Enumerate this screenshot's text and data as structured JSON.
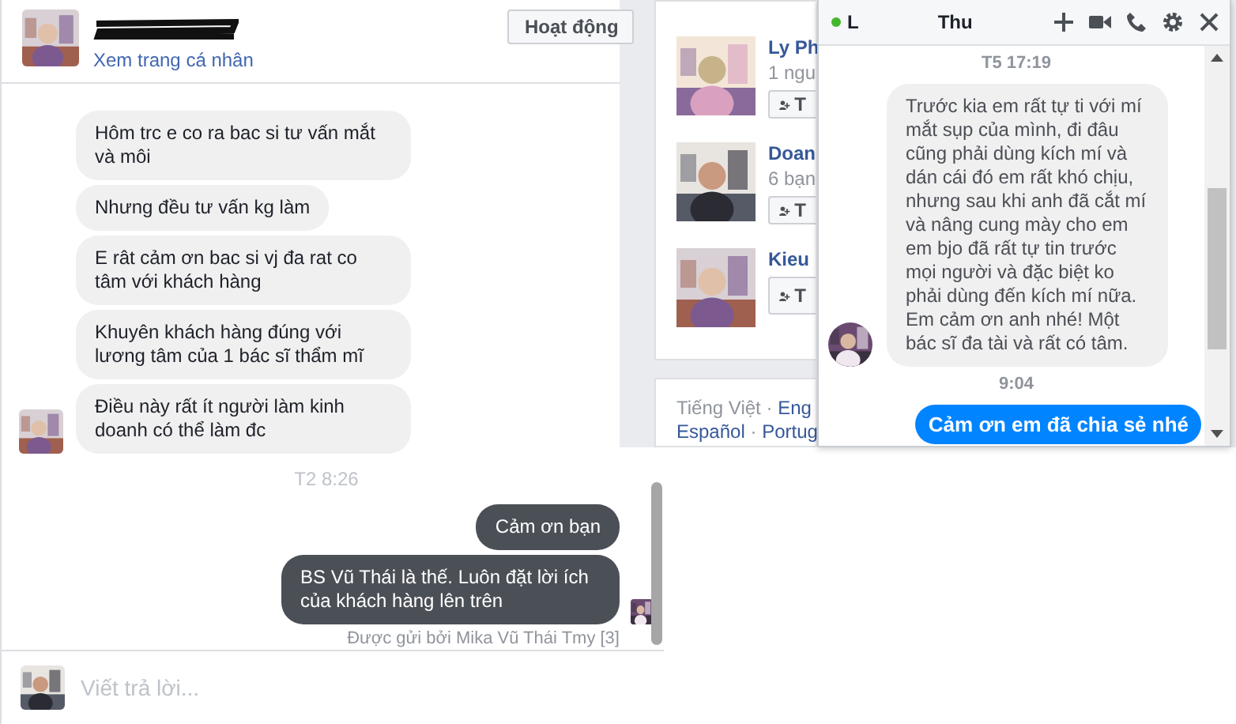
{
  "conversation": {
    "profile_link": "Xem trang cá nhân",
    "status_button": "Hoạt động",
    "incoming": [
      "Hôm trc e co ra bac si tư vấn mắt và môi",
      "Nhưng đều tư vấn kg làm",
      "E rât cảm ơn bac si vj đa rat co tâm với khách hàng",
      "Khuyên khách hàng đúng với lương tâm của 1 bác sĩ thẩm mĩ",
      "Điều này rất ít người làm kinh doanh có thể làm đc"
    ]
  },
  "thread": {
    "timestamp": "T2 8:26",
    "outgoing": [
      "Cảm ơn bạn",
      "BS Vũ Thái là thế. Luôn đặt lời ích của khách hàng lên trên"
    ],
    "sent_by": "Được gửi bởi Mika Vũ Thái Tmy [3]",
    "reply": {
      "placeholder": "Viết trả lời..."
    }
  },
  "suggestions": [
    {
      "name": "Ly Ph",
      "detail": "1 ngu",
      "button": "T"
    },
    {
      "name": "Doan",
      "detail": "6 bạn",
      "button": "T"
    },
    {
      "name": "Kieu",
      "button": "T"
    }
  ],
  "languages": [
    [
      "Tiếng Việt",
      "·",
      "Eng"
    ],
    [
      "Español",
      "·",
      "Portug"
    ]
  ],
  "chat": {
    "online": true,
    "title_start": "L",
    "title_end": "Thu",
    "messages": [
      {
        "kind": "time",
        "text": "T5 17:19"
      },
      {
        "kind": "in",
        "text": "Trước kia em rất tự ti với mí mắt sụp của mình, đi đâu cũng phải dùng kích mí và dán cái đó em rất khó chịu, nhưng sau khi anh đã cắt mí và nâng cung mày cho em em bjo đã rất tự tin trước mọi người và đặc biệt ko phải dùng đến kích mí nữa. Em cảm ơn anh nhé! Một bác sĩ đa tài và rất có tâm."
      },
      {
        "kind": "time",
        "text": "9:04"
      },
      {
        "kind": "out",
        "text": "Cảm ơn em đã chia sẻ nhé"
      }
    ]
  }
}
